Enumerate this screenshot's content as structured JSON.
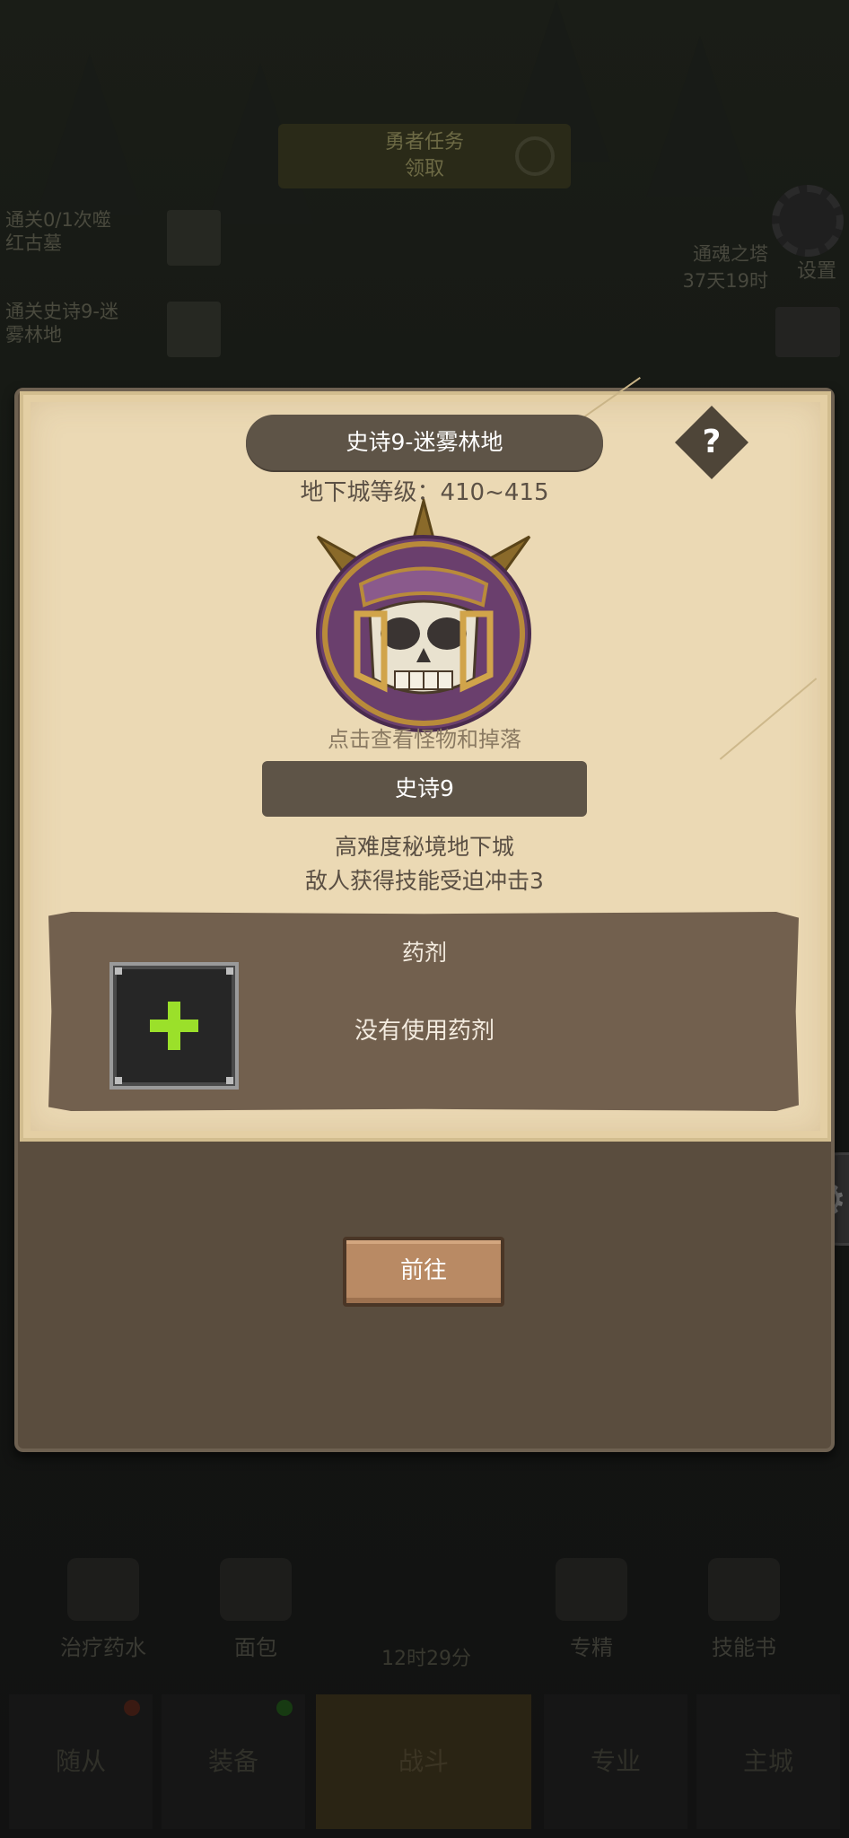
{
  "background": {
    "task_button": {
      "title": "勇者任务",
      "subtitle": "领取"
    },
    "quests": [
      {
        "text": "通关0/1次噬\n红古墓"
      },
      {
        "text": "通关史诗9-迷\n雾林地"
      }
    ],
    "tower": {
      "name": "通魂之塔",
      "timer": "37天19时"
    },
    "settings_label": "设置",
    "bottom_items": [
      {
        "label": "治疗药水"
      },
      {
        "label": "面包"
      },
      {
        "label": "专精"
      },
      {
        "label": "技能书"
      }
    ],
    "center_timer": "12时29分",
    "tabs": [
      {
        "label": "随从"
      },
      {
        "label": "装备"
      },
      {
        "label": "战斗"
      },
      {
        "label": "专业"
      },
      {
        "label": "主城"
      }
    ]
  },
  "dialog": {
    "title": "史诗9-迷雾林地",
    "help_label": "?",
    "dungeon_level": "地下城等级：410~415",
    "monster_hint": "点击查看怪物和掉落",
    "difficulty_name": "史诗9",
    "description_line1": "高难度秘境地下城",
    "description_line2": "敌人获得技能受迫冲击3",
    "potion": {
      "title": "药剂",
      "status": "没有使用药剂",
      "slot_icon": "plus-icon"
    },
    "go_button": "前往"
  },
  "colors": {
    "paper": "#ebd9b4",
    "dark_pill": "#5e5447",
    "potion_panel": "#72604e",
    "plus_green": "#9be02a",
    "go_button": "#b98a64"
  }
}
